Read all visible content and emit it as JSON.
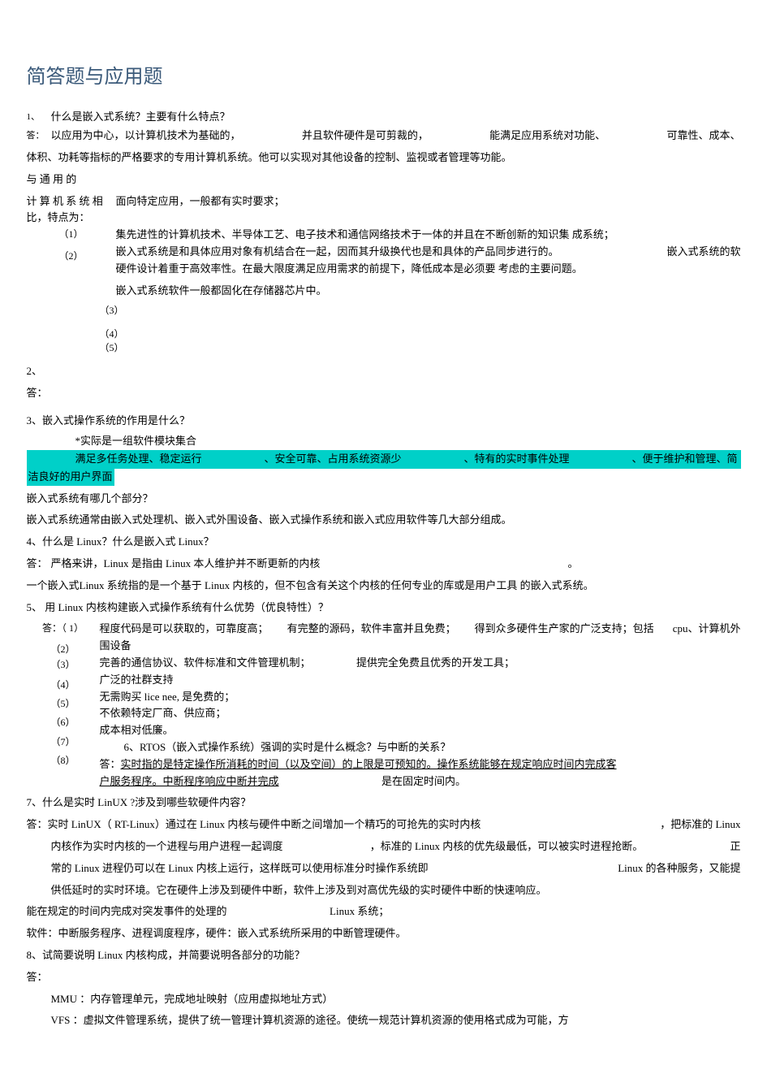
{
  "title": "简答题与应用题",
  "q1": {
    "num": "1、",
    "label": "答：",
    "question": "什么是嵌入式系统？主要有什么特点？",
    "ans1a": "以应用为中心，以计算机技术为基础的，",
    "ans1b": "并且软件硬件是可剪裁的，",
    "ans1c": "能满足应用系统对功能、",
    "ans1d": "可靠性、成本、",
    "ans2": "体积、功耗等指标的严格要求的专用计算机系统。他可以实现对其他设备的控制、监视或者管理等功能。",
    "compare": "与 通 用 的",
    "compare2a": "计 算 机 系 统 相",
    "compare2b": "比，特点为：",
    "feat_head": "面向特定应用，一般都有实时要求；",
    "feat1": "集先进性的计算机技术、半导体工艺、电子技术和通信网络技术于一体的并且在不断创新的知识集  成系统；",
    "feat2a": "嵌入式系统是和具体应用对象有机结合在一起，因而其升级换代也是和具体的产品同步进行的。",
    "feat2b": "嵌入式系统的软",
    "feat3": "硬件设计着重于高效率性。在最大限度满足应用需求的前提下，降低成本是必须要  考虑的主要问题。",
    "feat4": "嵌入式系统软件一般都固化在存储器芯片中。",
    "n1": "（1）",
    "n2": "（2）",
    "n3": "（3）",
    "n4": "（4）",
    "n5": "（5）"
  },
  "q2": {
    "num": "2、",
    "label": "答："
  },
  "q3": {
    "num": "3、",
    "title": "嵌入式操作系统的作用是什么？",
    "sub": "*实际是一组软件模块集合",
    "hl1": "满足多任务处理、稳定运行",
    "hl2": "、安全可靠、占用系统资源少",
    "hl3": "、特有的实时事件处理",
    "hl4": "、便于维护和管理、简",
    "hl5": "洁良好的用户界面",
    "subq": "嵌入式系统有哪几个部分？",
    "suba": "嵌入式系统通常由嵌入式处理机、嵌入式外围设备、嵌入式操作系统和嵌入式应用软件等几大部分组成。"
  },
  "q4": {
    "num": "4、",
    "title": "什么是 Linux？什么是嵌入式  Linux？",
    "ans1": "严格来讲，Linux 是指由 Linux 本人维护并不断更新的内核",
    "dot": "。",
    "ans2": "一个嵌入式Linux 系统指的是一个基于  Linux 内核的，但不包含有关这个内核的任何专业的库或是用户工具  的嵌入式系统。"
  },
  "q5": {
    "num": "5、",
    "title": "用 Linux 内核构建嵌入式操作系统有什么优势（优良特性）？",
    "preA": "答：（ 1）",
    "n2": "（2）",
    "n3": "（3）",
    "n4": "（4）",
    "n5": "（5）",
    "n6": "（6）",
    "n7": "（7）",
    "n8": "（8）",
    "i1a": "程度代码是可以获取的，可靠度高；",
    "i1b": "有完整的源码，软件丰富并且免费；",
    "i1c": "得到众多硬件生产家的广泛支持；包括",
    "i1d": "cpu、计算机外",
    "i1e": "围设备",
    "i2": "完善的通信协议、软件标准和文件管理机制；",
    "i2b": "提供完全免费且优秀的开发工具；",
    "i3": "广泛的社群支持",
    "i4": "无需购买 lice nee, 是免费的；",
    "i5": "不依赖特定厂商、供应商；",
    "i6": "成本相对低廉。",
    "i7": "6、RTOS（嵌入式操作系统）强调的实时是什么概念？与中断的关系？",
    "i8a": "答：",
    "i8b": "实时指的是特定操作所消耗的时间（以及空间）的上限是可预知的。操作系统能够在规定响应时间内完成客",
    "i8c": "户服务程序。中断程序响应中断并完成",
    "i8d": "是在固定时间内。"
  },
  "q7": {
    "num": "7、",
    "title": "什么是实时  LinUX ?涉及到哪些软硬件内容？",
    "a1a": "答：实时 LinUX（  RT-Linux）通过在 Linux 内核与硬件中断之间增加一个精巧的可抢先的实时内核",
    "a1b": "，把标准的 Linux",
    "a2a": "内核作为实时内核的一个进程与用户进程一起调度",
    "a2b": "，标准的 Linux 内核的优先级最低，可以被实时进程抢断。",
    "a2c": "正",
    "a3a": "常的 Linux 进程仍可以在 Linux 内核上运行，这样既可以使用标准分时操作系统即",
    "a3b": "Linux 的各种服务，又能提",
    "a4": "供低延时的实时环境。它在硬件上涉及到硬件中断，软件上涉及到对高优先级的实时硬件中断的快速响应。",
    "a5a": "能在规定的时间内完成对突发事件的处理的",
    "a5b": "Linux 系统；",
    "a6": "软件：中断服务程序、进程调度程序，硬件：嵌入式系统所采用的中断管理硬件。"
  },
  "q8": {
    "num": "8、",
    "title": "试简要说明  Linux 内核构成，并简要说明各部分的功能？",
    "label": "答：",
    "mmu": "MMU ：内存管理单元，完成地址映射（应用虚拟地址方式）",
    "vfs": "VFS ：虚拟文件管理系统，提供了统一管理计算机资源的途径。使统一规范计算机资源的使用格式成为可能，方"
  }
}
